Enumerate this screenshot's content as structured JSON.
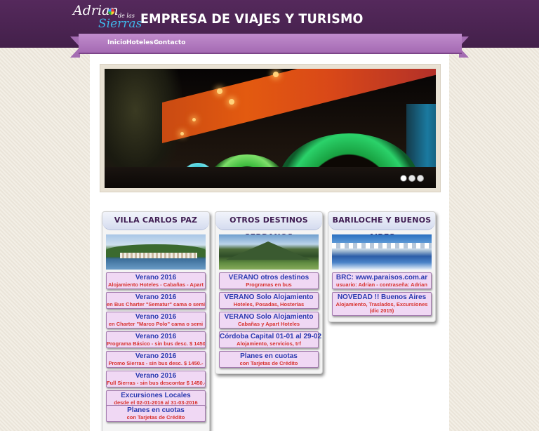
{
  "header": {
    "logo": {
      "line1": "Adrian",
      "line2": "Sierras",
      "small": "de las"
    },
    "title": "EMPRESA DE VIAJES Y TURISMO"
  },
  "nav": [
    {
      "label": "Inicio"
    },
    {
      "label": "Hoteles »"
    },
    {
      "label": "Contacto"
    }
  ],
  "slider": {
    "dots": 3,
    "active_dot": 1
  },
  "columns": [
    {
      "title": "VILLA CARLOS PAZ",
      "items": [
        {
          "title": "Verano 2016",
          "subtitle": "Alojamiento Hoteles - Cabañas - Apart"
        },
        {
          "title": "Verano 2016",
          "subtitle": "en Bus Charter \"Sematur\" cama o semi"
        },
        {
          "title": "Verano 2016",
          "subtitle": "en Charter \"Marco Polo\" cama o semi"
        },
        {
          "title": "Verano 2016",
          "subtitle": "Programa Básico - sin bus desc. $ 1450"
        },
        {
          "title": "Verano 2016",
          "subtitle": "Promo Sierras - sin bus desc. $ 1450.-"
        },
        {
          "title": "Verano 2016",
          "subtitle": "Full Sierras - sin bus descontar $ 1450.-"
        },
        {
          "title": "Excursiones Locales",
          "subtitle": "desde el 02-01-2016 al 31-03-2016"
        },
        {
          "title": "Planes en cuotas",
          "subtitle": "con Tarjetas de Crédito"
        }
      ]
    },
    {
      "title": "OTROS DESTINOS SERRANOS",
      "items": [
        {
          "title": "VERANO otros destinos",
          "subtitle": "Programas en bus"
        },
        {
          "title": "VERANO Solo Alojamiento",
          "subtitle": "Hoteles, Posadas, Hosterías"
        },
        {
          "title": "VERANO Solo Alojamiento",
          "subtitle": "Cabañas y Apart Hoteles"
        },
        {
          "title": "Córdoba Capital 01-01 al 29-02",
          "subtitle": "Alojamiento, servicios, trf"
        },
        {
          "title": "Planes en cuotas",
          "subtitle": "con Tarjetas de Crédito"
        }
      ]
    },
    {
      "title": "BARILOCHE Y BUENOS AIRES",
      "items": [
        {
          "title": "BRC: www.paraisos.com.ar",
          "subtitle": "usuario: Adrian - contraseña: Adrian"
        },
        {
          "title": "NOVEDAD !! Buenos Aires",
          "subtitle": "Alojamiento, Traslados, Excursiones (dic 2015)"
        }
      ]
    }
  ],
  "colors": {
    "header_bg": "#4a2550",
    "nav_bg": "#b27cc0",
    "button_bg": "#f0d8f4",
    "button_title": "#2a3bb0",
    "button_subtitle": "#d8322e",
    "column_title": "#3f1d52"
  }
}
